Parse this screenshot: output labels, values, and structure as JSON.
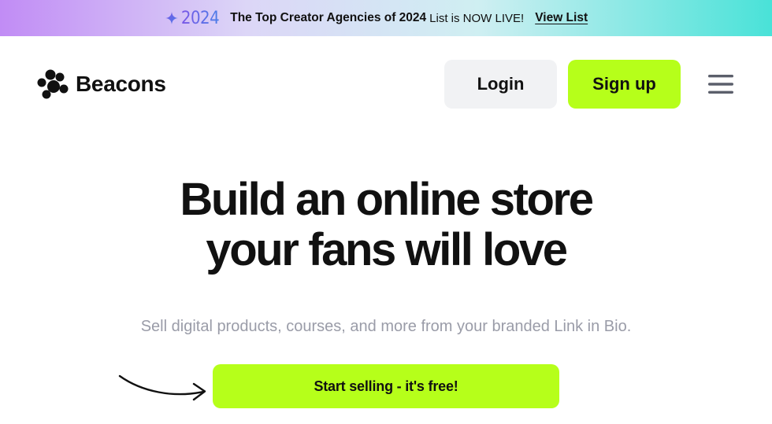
{
  "banner": {
    "year": "2024",
    "headline": "The Top Creator Agencies of 2024",
    "suffix": "List is NOW LIVE!",
    "link_label": "View List",
    "sparkle_icon": "sparkle-icon"
  },
  "header": {
    "logo_text": "Beacons",
    "logo_icon": "paw-dots-icon",
    "login_label": "Login",
    "signup_label": "Sign up",
    "menu_icon": "hamburger-menu-icon"
  },
  "hero": {
    "title_line1": "Build an online store",
    "title_line2": "your fans will love",
    "subtitle": "Sell digital products, courses, and more from your branded Link in Bio.",
    "cta_label": "Start selling  - it's free!",
    "arrow_icon": "curved-arrow-icon"
  },
  "colors": {
    "accent": "#b6ff1a",
    "login_bg": "#f1f2f4",
    "text": "#111111",
    "subtitle": "#9a9ca8",
    "year_gradient_start": "#7a56e6",
    "year_gradient_end": "#4a7de8"
  }
}
